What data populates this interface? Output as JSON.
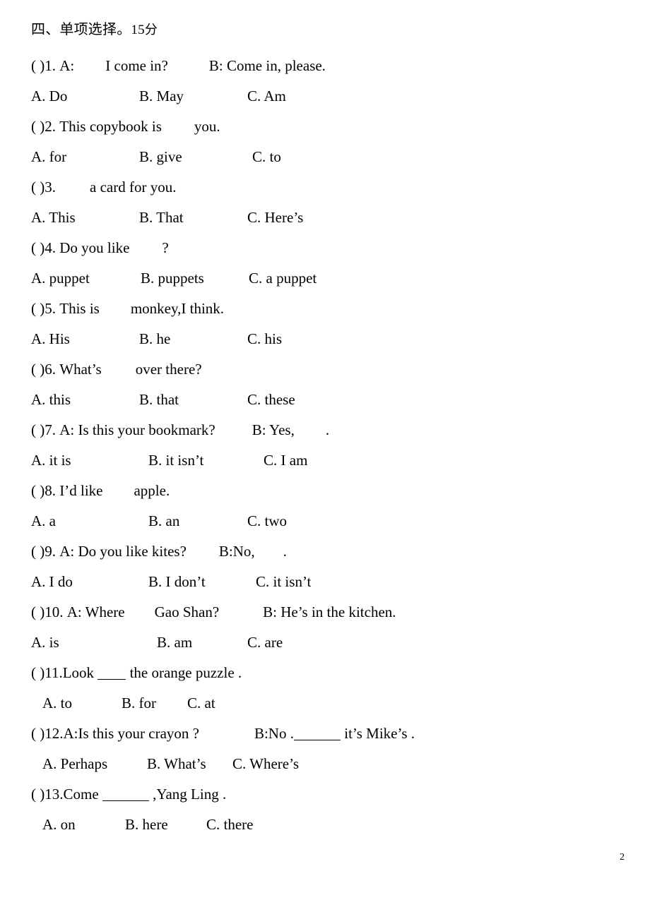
{
  "document": {
    "page_number": "2",
    "section": {
      "number_cn": "四、",
      "title_cn": "单项选择。",
      "marks": "15",
      "marks_unit_cn": "分"
    }
  },
  "questions": [
    {
      "bracket": "(    )",
      "number": "1.",
      "stem_before": "A:",
      "stem_after": "I come in?",
      "stem_tail": "B: Come in, please.",
      "options": [
        {
          "key": "A.",
          "text": "Do"
        },
        {
          "key": "B.",
          "text": "May"
        },
        {
          "key": "C.",
          "text": "Am"
        }
      ]
    },
    {
      "bracket": "(    )",
      "number": "2.",
      "stem_before": "This copybook is",
      "stem_after": "you.",
      "stem_tail": "",
      "options": [
        {
          "key": "A.",
          "text": "for"
        },
        {
          "key": "B.",
          "text": "give"
        },
        {
          "key": "C.",
          "text": "to"
        }
      ]
    },
    {
      "bracket": "(    )",
      "number": "3.",
      "stem_before": "",
      "stem_after": "a card for you.",
      "stem_tail": "",
      "options": [
        {
          "key": "A.",
          "text": "This"
        },
        {
          "key": "B.",
          "text": "That"
        },
        {
          "key": "C.",
          "text": "Here’s"
        }
      ]
    },
    {
      "bracket": "(    )",
      "number": "4.",
      "stem_before": "Do you like",
      "stem_after": "?",
      "stem_tail": "",
      "options": [
        {
          "key": "A.",
          "text": "puppet"
        },
        {
          "key": "B.",
          "text": "puppets"
        },
        {
          "key": "C.",
          "text": "a puppet"
        }
      ]
    },
    {
      "bracket": "(    )",
      "number": "5.",
      "stem_before": "This is",
      "stem_after": "monkey,I think.",
      "stem_tail": "",
      "options": [
        {
          "key": "A.",
          "text": "His"
        },
        {
          "key": "B.",
          "text": "he"
        },
        {
          "key": "C.",
          "text": "his"
        }
      ]
    },
    {
      "bracket": "(    )",
      "number": "6.",
      "stem_before": "What’s",
      "stem_after": "over there?",
      "stem_tail": "",
      "options": [
        {
          "key": "A.",
          "text": "this"
        },
        {
          "key": "B.",
          "text": "that"
        },
        {
          "key": "C.",
          "text": "these"
        }
      ]
    },
    {
      "bracket": "(    )",
      "number": "7.",
      "stem_before": "A: Is this your bookmark?",
      "stem_after": "B: Yes,",
      "stem_tail": ".",
      "options": [
        {
          "key": "A.",
          "text": "it is"
        },
        {
          "key": "B.",
          "text": "it isn’t"
        },
        {
          "key": "C.",
          "text": "I am"
        }
      ]
    },
    {
      "bracket": "(    )",
      "number": "8.",
      "stem_before": "I’d like",
      "stem_after": "apple.",
      "stem_tail": "",
      "options": [
        {
          "key": "A.",
          "text": "a"
        },
        {
          "key": "B.",
          "text": "an"
        },
        {
          "key": "C.",
          "text": "two"
        }
      ]
    },
    {
      "bracket": "(    )",
      "number": "9.",
      "stem_before": "A: Do you like kites?",
      "stem_after": "B:No,",
      "stem_tail": ".",
      "options": [
        {
          "key": "A.",
          "text": "I do"
        },
        {
          "key": "B.",
          "text": "I don’t"
        },
        {
          "key": "C.",
          "text": "it isn’t"
        }
      ]
    },
    {
      "bracket": "(    )",
      "number": "10.",
      "stem_before": "A: Where",
      "stem_after": "Gao Shan?",
      "stem_tail": "B: He’s in the kitchen.",
      "options": [
        {
          "key": "A.",
          "text": "is"
        },
        {
          "key": "B.",
          "text": "am"
        },
        {
          "key": "C.",
          "text": "are"
        }
      ]
    },
    {
      "bracket": "(    )",
      "number": "11.",
      "stem_before": "Look",
      "stem_after": "the orange puzzle .",
      "stem_tail": "",
      "options": [
        {
          "key": "A.",
          "text": "to"
        },
        {
          "key": "B.",
          "text": "for"
        },
        {
          "key": "C.",
          "text": "at"
        }
      ]
    },
    {
      "bracket": "(    )",
      "number": "12.",
      "stem_before": "A:Is this your crayon ?",
      "stem_after": "B:No .",
      "stem_tail": "it’s Mike’s .",
      "options": [
        {
          "key": "A.",
          "text": "Perhaps"
        },
        {
          "key": "B.",
          "text": "What’s"
        },
        {
          "key": "C.",
          "text": "Where’s"
        }
      ]
    },
    {
      "bracket": "(    )",
      "number": "13.",
      "stem_before": "Come",
      "stem_after": ",Yang Ling .",
      "stem_tail": "",
      "options": [
        {
          "key": "A.",
          "text": "on"
        },
        {
          "key": "B.",
          "text": "here"
        },
        {
          "key": "C.",
          "text": "there"
        }
      ]
    }
  ]
}
